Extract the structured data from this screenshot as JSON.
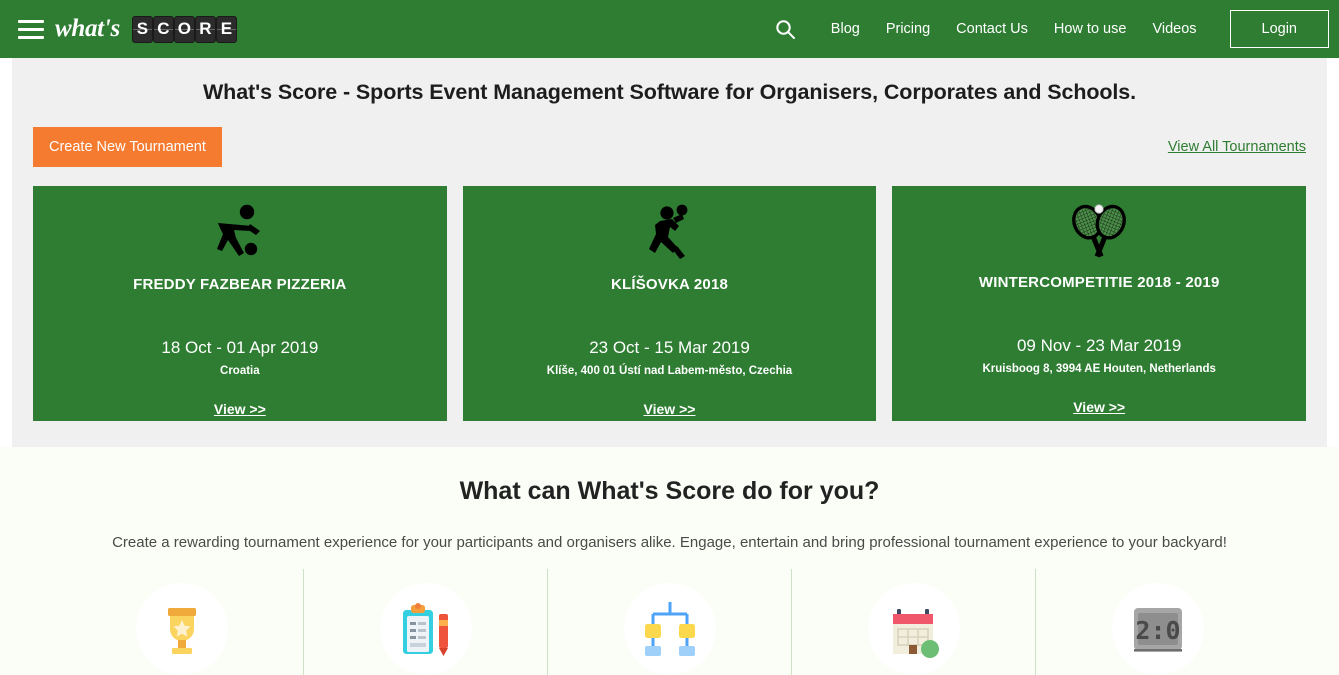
{
  "header": {
    "logo": {
      "script_word": "what's",
      "tiles": [
        "S",
        "C",
        "O",
        "R",
        "E"
      ],
      "menu_icon": "hamburger-icon"
    },
    "search_icon": "search-icon",
    "nav_links": [
      {
        "label": "Blog"
      },
      {
        "label": "Pricing"
      },
      {
        "label": "Contact Us"
      },
      {
        "label": "How to use"
      },
      {
        "label": "Videos"
      }
    ],
    "login_label": "Login",
    "background_color": "#2E7D32"
  },
  "hero": {
    "title": "What's Score - Sports Event Management Software for Organisers, Corporates and Schools.",
    "create_button_label": "Create New Tournament",
    "create_button_color": "#F47B30",
    "view_all_label": "View All Tournaments",
    "view_all_color": "#2E7D32",
    "background_color": "#F0F0F0"
  },
  "tournaments": [
    {
      "icon": "soccer-player-icon",
      "title": "FREDDY FAZBEAR PIZZERIA",
      "dates": "18 Oct - 01 Apr 2019",
      "venue": "Croatia",
      "view_label": "View >>"
    },
    {
      "icon": "handball-player-icon",
      "title": "KLÍŠOVKA 2018",
      "dates": "23 Oct - 15 Mar 2019",
      "venue": "Klíše, 400 01 Ústí nad Labem-město, Czechia",
      "view_label": "View >>"
    },
    {
      "icon": "tennis-rackets-icon",
      "title": "WINTERCOMPETITIE 2018 - 2019",
      "dates": "09 Nov - 23 Mar 2019",
      "venue": "Kruisboog 8, 3994 AE Houten, Netherlands",
      "view_label": "View >>"
    }
  ],
  "features": {
    "title": "What can What's Score do for you?",
    "subtitle": "Create a rewarding tournament experience for your participants and organisers alike. Engage, entertain and bring professional tournament experience to your backyard!",
    "background_color": "#FBFEF6",
    "items": [
      {
        "icon": "trophy-icon"
      },
      {
        "icon": "clipboard-pen-icon"
      },
      {
        "icon": "bracket-tree-icon"
      },
      {
        "icon": "calendar-venue-icon"
      },
      {
        "icon": "scoreboard-icon"
      }
    ]
  }
}
